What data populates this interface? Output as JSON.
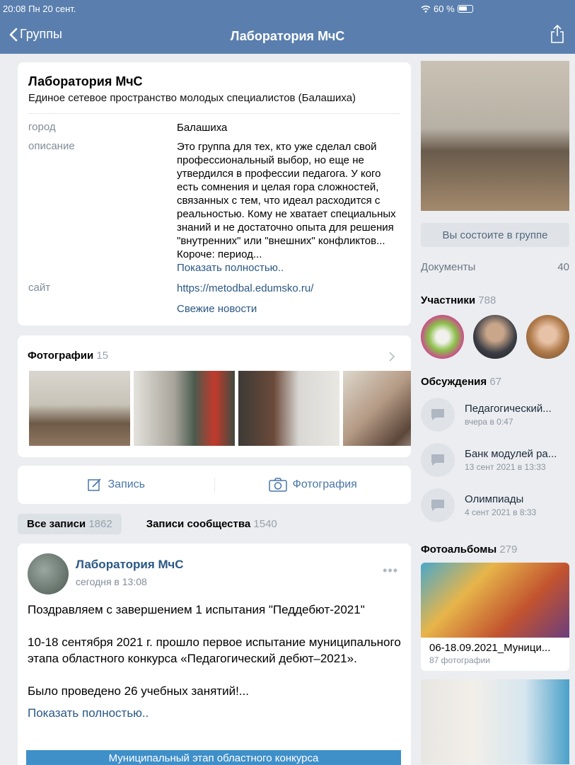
{
  "status_bar": {
    "time": "20:08  Пн 20 сент.",
    "battery": "60 %"
  },
  "nav": {
    "back_label": "Группы",
    "title": "Лаборатория МчС"
  },
  "info": {
    "name": "Лаборатория МчС",
    "subtitle": "Единое сетевое пространство молодых специалистов (Балашиха)",
    "city_label": "город",
    "city": "Балашиха",
    "description_label": "описание",
    "description": "Это группа для тех, кто уже сделал свой профессиональный выбор, но еще не утвердился в профессии педагога. У кого есть сомнения  и целая гора сложностей, связанных с тем, что идеал расходится с реальностью. Кому не хватает специальных знаний и не достаточно опыта для решения \"внутренних\" или \"внешних\" конфликтов... Короче: период...",
    "show_more": "Показать полностью..",
    "site_label": "сайт",
    "site": "https://metodbal.edumsko.ru/",
    "news_link": "Свежие новости"
  },
  "photos": {
    "title": "Фотографии",
    "count": "15"
  },
  "actions": {
    "post": "Запись",
    "photo": "Фотография"
  },
  "tabs": {
    "all_label": "Все записи",
    "all_count": "1862",
    "community_label": "Записи сообщества",
    "community_count": "1540"
  },
  "post": {
    "author": "Лаборатория МчС",
    "time": "сегодня в 13:08",
    "text1": "Поздравляем с завершением 1 испытания \"Педдебют-2021\"",
    "text2": "10-18 сентября 2021 г. прошло первое испытание муниципального этапа областного конкурса «Педагогический дебют–2021».",
    "text3": "Было проведено 26 учебных занятий!...",
    "show_more": "Показать полностью..",
    "banner": "Муниципальный этап областного конкурса"
  },
  "sidebar": {
    "member_button": "Вы состоите в группе",
    "docs_label": "Документы",
    "docs_count": "40",
    "members_label": "Участники",
    "members_count": "788",
    "discussions_label": "Обсуждения",
    "discussions_count": "67",
    "discussions": [
      {
        "title": "Педагогический...",
        "date": "вчера в 0:47"
      },
      {
        "title": "Банк модулей ра...",
        "date": "13 сент 2021 в 13:33"
      },
      {
        "title": "Олимпиады",
        "date": "4 сент 2021 в 8:33"
      }
    ],
    "albums_label": "Фотоальбомы",
    "albums_count": "279",
    "album": {
      "title": "06-18.09.2021_Муници...",
      "count": "87 фотографии"
    }
  },
  "colors": {
    "header": "#5a7fae",
    "link": "#2a5885",
    "accent": "#4a76a8",
    "background": "#ebedf0"
  }
}
